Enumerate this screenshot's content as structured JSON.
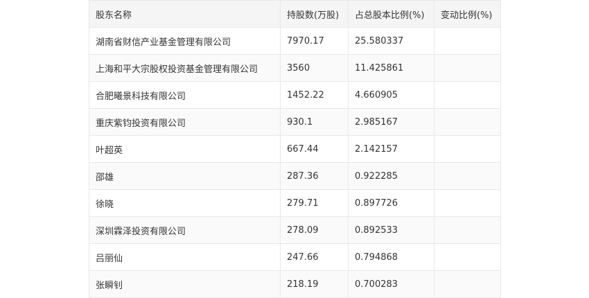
{
  "table": {
    "headers": [
      "股东名称",
      "持股数(万股)",
      "占总股本比例(%)",
      "变动比例(%)"
    ],
    "rows": [
      [
        "湖南省财信产业基金管理有限公司",
        "7970.17",
        "25.580337",
        ""
      ],
      [
        "上海和平大宗股权投资基金管理有限公司",
        "3560",
        "11.425861",
        ""
      ],
      [
        "合肥曦景科技有限公司",
        "1452.22",
        "4.660905",
        ""
      ],
      [
        "重庆紫钧投资有限公司",
        "930.1",
        "2.985167",
        ""
      ],
      [
        "叶超英",
        "667.44",
        "2.142157",
        ""
      ],
      [
        "邵雄",
        "287.36",
        "0.922285",
        ""
      ],
      [
        "徐晓",
        "279.71",
        "0.897726",
        ""
      ],
      [
        "深圳霖泽投资有限公司",
        "278.09",
        "0.892533",
        ""
      ],
      [
        "吕丽仙",
        "247.66",
        "0.794868",
        ""
      ],
      [
        "张瞬钊",
        "218.19",
        "0.700283",
        ""
      ]
    ]
  }
}
